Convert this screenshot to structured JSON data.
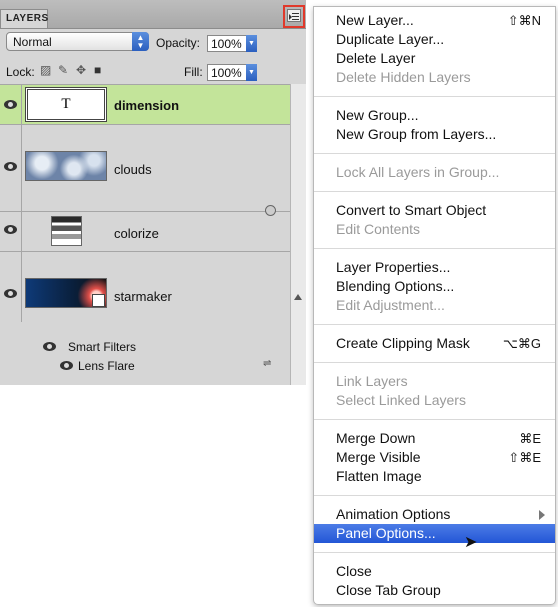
{
  "panel": {
    "tab_title": "LAYERS",
    "tab_close": "»",
    "blend_mode": "Normal",
    "opacity_label": "Opacity:",
    "opacity_value": "100%",
    "lock_label": "Lock:",
    "fill_label": "Fill:",
    "fill_value": "100%",
    "layers": [
      {
        "name": "dimension",
        "thumb": "T",
        "selected": true
      },
      {
        "name": "clouds",
        "selected": false
      },
      {
        "name": "colorize",
        "selected": false
      },
      {
        "name": "starmaker",
        "selected": false
      }
    ],
    "smart_filters_label": "Smart Filters",
    "lens_flare_label": "Lens Flare"
  },
  "menu": {
    "items": [
      {
        "label": "New Layer...",
        "shortcut": "⇧⌘N",
        "disabled": false
      },
      {
        "label": "Duplicate Layer...",
        "shortcut": "",
        "disabled": false
      },
      {
        "label": "Delete Layer",
        "shortcut": "",
        "disabled": false
      },
      {
        "label": "Delete Hidden Layers",
        "shortcut": "",
        "disabled": true
      },
      {
        "label": "New Group...",
        "shortcut": "",
        "disabled": false
      },
      {
        "label": "New Group from Layers...",
        "shortcut": "",
        "disabled": false
      },
      {
        "label": "Lock All Layers in Group...",
        "shortcut": "",
        "disabled": true
      },
      {
        "label": "Convert to Smart Object",
        "shortcut": "",
        "disabled": false
      },
      {
        "label": "Edit Contents",
        "shortcut": "",
        "disabled": true
      },
      {
        "label": "Layer Properties...",
        "shortcut": "",
        "disabled": false
      },
      {
        "label": "Blending Options...",
        "shortcut": "",
        "disabled": false
      },
      {
        "label": "Edit Adjustment...",
        "shortcut": "",
        "disabled": true
      },
      {
        "label": "Create Clipping Mask",
        "shortcut": "⌥⌘G",
        "disabled": false
      },
      {
        "label": "Link Layers",
        "shortcut": "",
        "disabled": true
      },
      {
        "label": "Select Linked Layers",
        "shortcut": "",
        "disabled": true
      },
      {
        "label": "Merge Down",
        "shortcut": "⌘E",
        "disabled": false
      },
      {
        "label": "Merge Visible",
        "shortcut": "⇧⌘E",
        "disabled": false
      },
      {
        "label": "Flatten Image",
        "shortcut": "",
        "disabled": false
      },
      {
        "label": "Animation Options",
        "shortcut": "",
        "disabled": false,
        "submenu": true
      },
      {
        "label": "Panel Options...",
        "shortcut": "",
        "disabled": false,
        "active": true
      },
      {
        "label": "Close",
        "shortcut": "",
        "disabled": false
      },
      {
        "label": "Close Tab Group",
        "shortcut": "",
        "disabled": false
      }
    ]
  },
  "colors": {
    "selected_row": "#c3e49a",
    "menu_highlight": "#2f62dc",
    "callout_border": "#e0392b"
  }
}
